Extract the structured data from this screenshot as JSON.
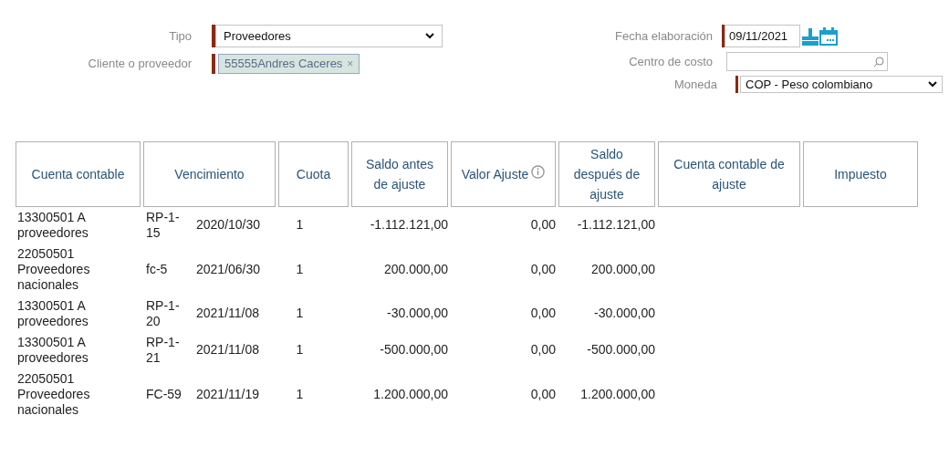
{
  "form": {
    "tipo": {
      "label": "Tipo",
      "value": "Proveedores"
    },
    "cliente": {
      "label": "Cliente o proveedor",
      "tag": "55555Andres Caceres",
      "remove": "×"
    },
    "fecha": {
      "label": "Fecha elaboración",
      "value": "09/11/2021"
    },
    "centro": {
      "label": "Centro de costo"
    },
    "moneda": {
      "label": "Moneda",
      "value": "COP - Peso colombiano"
    }
  },
  "table": {
    "columns": [
      {
        "label": "Cuenta contable",
        "info": false
      },
      {
        "label": "Vencimiento",
        "info": false
      },
      {
        "label": "Cuota",
        "info": false
      },
      {
        "label": "Saldo antes de ajuste",
        "info": false
      },
      {
        "label": "Valor Ajuste",
        "info": true
      },
      {
        "label": "Saldo después de ajuste",
        "info": false
      },
      {
        "label": "Cuenta contable de ajuste",
        "info": false
      },
      {
        "label": "Impuesto",
        "info": false
      }
    ],
    "rows": [
      {
        "cuenta": "13300501 A proveedores",
        "ref": "RP-1-15",
        "fecha": "2020/10/30",
        "cuota": "1",
        "saldo_antes": "-1.112.121,00",
        "valor": "0,00",
        "saldo_despues": "-1.112.121,00"
      },
      {
        "cuenta": "22050501 Proveedores nacionales",
        "ref": "fc-5",
        "fecha": "2021/06/30",
        "cuota": "1",
        "saldo_antes": "200.000,00",
        "valor": "0,00",
        "saldo_despues": "200.000,00"
      },
      {
        "cuenta": "13300501 A proveedores",
        "ref": "RP-1-20",
        "fecha": "2021/11/08",
        "cuota": "1",
        "saldo_antes": "-30.000,00",
        "valor": "0,00",
        "saldo_despues": "-30.000,00"
      },
      {
        "cuenta": "13300501 A proveedores",
        "ref": "RP-1-21",
        "fecha": "2021/11/08",
        "cuota": "1",
        "saldo_antes": "-500.000,00",
        "valor": "0,00",
        "saldo_despues": "-500.000,00"
      },
      {
        "cuenta": "22050501 Proveedores nacionales",
        "ref": "FC-59",
        "fecha": "2021/11/19",
        "cuota": "1",
        "saldo_antes": "1.200.000,00",
        "valor": "0,00",
        "saldo_despues": "1.200.000,00"
      }
    ]
  }
}
